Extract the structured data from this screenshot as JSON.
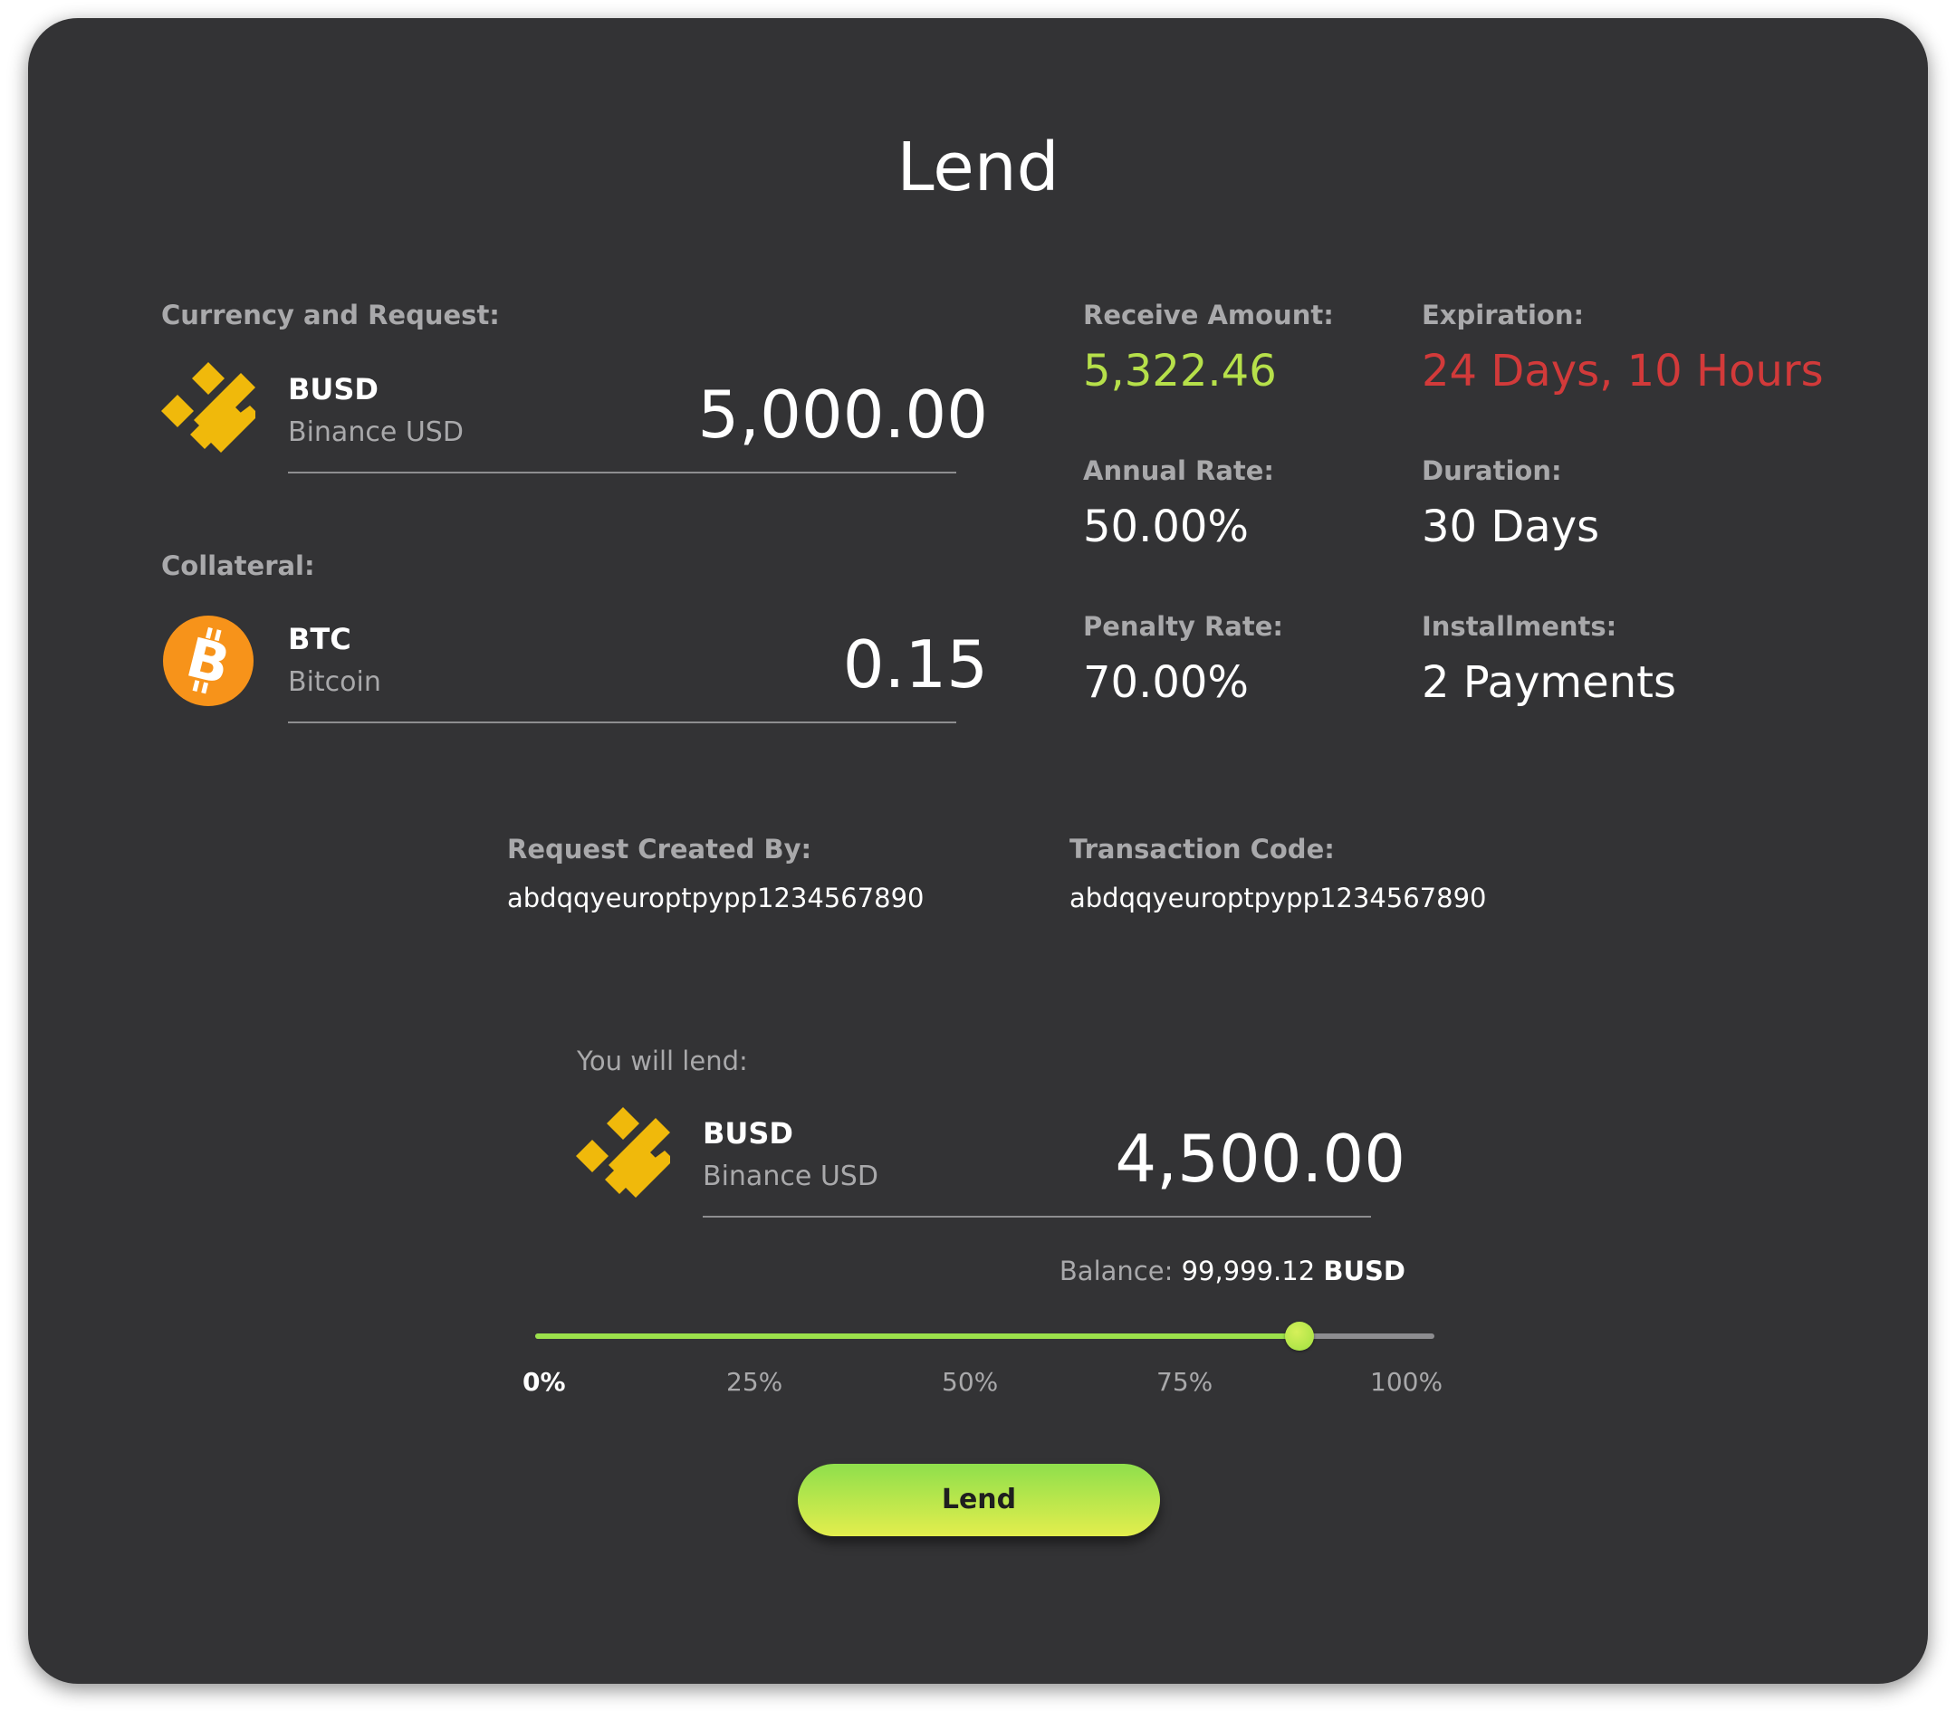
{
  "title": "Lend",
  "request": {
    "label": "Currency and Request:",
    "ticker": "BUSD",
    "name": "Binance USD",
    "amount": "5,000.00",
    "icon": "busd-icon"
  },
  "collateral": {
    "label": "Collateral:",
    "ticker": "BTC",
    "name": "Bitcoin",
    "amount": "0.15",
    "icon": "btc-icon"
  },
  "stats": {
    "receive_label": "Receive Amount:",
    "receive_value": "5,322.46",
    "expiration_label": "Expiration:",
    "expiration_value": "24 Days, 10 Hours",
    "annual_label": "Annual Rate:",
    "annual_value": "50.00%",
    "duration_label": "Duration:",
    "duration_value": "30 Days",
    "penalty_label": "Penalty Rate:",
    "penalty_value": "70.00%",
    "installments_label": "Installments:",
    "installments_value": "2 Payments"
  },
  "meta": {
    "created_by_label": "Request Created By:",
    "created_by_value": "abdqqyeuroptpypp1234567890",
    "tx_label": "Transaction Code:",
    "tx_value": "abdqqyeuroptpypp1234567890"
  },
  "lend": {
    "label": "You will lend:",
    "ticker": "BUSD",
    "name": "Binance USD",
    "amount": "4,500.00",
    "balance_label": "Balance:",
    "balance_value": "99,999.12",
    "balance_unit": "BUSD",
    "icon": "busd-icon"
  },
  "slider": {
    "value_fraction": 0.85,
    "ticks": [
      "0%",
      "25%",
      "50%",
      "75%",
      "100%"
    ],
    "active_tick": "0%"
  },
  "button": {
    "label": "Lend"
  },
  "colors": {
    "card_bg": "#333335",
    "receive": "#b6e04a",
    "expiration": "#d23a3a",
    "accent_green": "#9be04b",
    "busd": "#f0b90b",
    "btc": "#f7931a"
  }
}
